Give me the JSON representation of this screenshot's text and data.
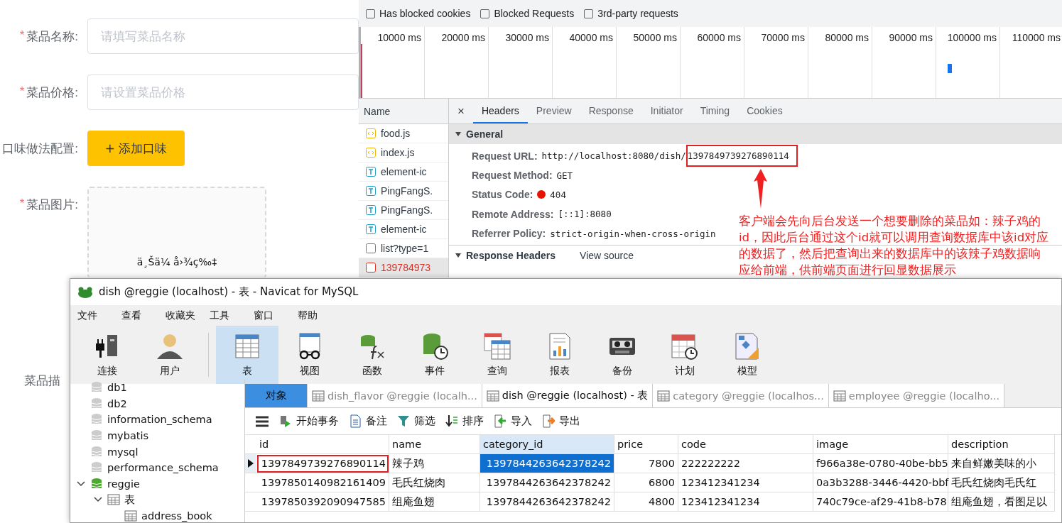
{
  "form": {
    "required_mark": "*",
    "fields": [
      {
        "label": "菜品名称:",
        "required": true,
        "kind": "input",
        "placeholder": "请填写菜品名称"
      },
      {
        "label": "菜品价格:",
        "required": true,
        "kind": "input",
        "placeholder": "请设置菜品价格"
      },
      {
        "label": "口味做法配置:",
        "required": false,
        "kind": "button",
        "button": "+ 添加口味"
      },
      {
        "label": "菜品图片:",
        "required": true,
        "kind": "upload",
        "upload_text": "ä¸Šä¼ å›¾ç‰‡"
      },
      {
        "label": "菜品描",
        "required": false,
        "kind": "label"
      }
    ]
  },
  "devtools": {
    "filters": [
      {
        "label": "Has blocked cookies",
        "checked": false
      },
      {
        "label": "Blocked Requests",
        "checked": false
      },
      {
        "label": "3rd-party requests",
        "checked": false
      }
    ],
    "timeline_ticks": [
      "10000 ms",
      "20000 ms",
      "30000 ms",
      "40000 ms",
      "50000 ms",
      "60000 ms",
      "70000 ms",
      "80000 ms",
      "90000 ms",
      "100000 ms",
      "110000 ms"
    ],
    "name_header": "Name",
    "requests": [
      {
        "name": "food.js",
        "kind": "script",
        "selected": false
      },
      {
        "name": "index.js",
        "kind": "script",
        "selected": false
      },
      {
        "name": "element-ic",
        "kind": "font",
        "selected": false
      },
      {
        "name": "PingFangS.",
        "kind": "font",
        "selected": false
      },
      {
        "name": "PingFangS.",
        "kind": "font",
        "selected": false
      },
      {
        "name": "element-ic",
        "kind": "font",
        "selected": false
      },
      {
        "name": "list?type=1",
        "kind": "xhr",
        "selected": false
      },
      {
        "name": "139784973",
        "kind": "error",
        "selected": true
      }
    ],
    "close": "×",
    "tabs": [
      {
        "label": "Headers",
        "selected": true
      },
      {
        "label": "Preview",
        "selected": false
      },
      {
        "label": "Response",
        "selected": false
      },
      {
        "label": "Initiator",
        "selected": false
      },
      {
        "label": "Timing",
        "selected": false
      },
      {
        "label": "Cookies",
        "selected": false
      }
    ],
    "general": {
      "title": "General",
      "expanded": true,
      "rows": [
        {
          "key": "Request URL:",
          "kind": "url",
          "value": "http://localhost:8080/dish/",
          "highlight": "1397849739276890114"
        },
        {
          "key": "Request Method:",
          "kind": "text",
          "value": "GET"
        },
        {
          "key": "Status Code:",
          "kind": "status",
          "value": "404",
          "color": "#e51400"
        },
        {
          "key": "Remote Address:",
          "kind": "text",
          "value": "[::1]:8080"
        },
        {
          "key": "Referrer Policy:",
          "kind": "text",
          "value": "strict-origin-when-cross-origin"
        }
      ]
    },
    "response_headers": {
      "title": "Response Headers",
      "expanded": true,
      "link": "View source"
    }
  },
  "annotation": {
    "text": "客户端会先向后台发送一个想要删除的菜品如：辣子鸡的id，因此后台通过这个id就可以调用查询数据库中该id对应的数据了，然后把查询出来的数据库中的该辣子鸡数据响应给前端，供前端页面进行回显数据展示"
  },
  "navicat": {
    "title": "dish @reggie (localhost) - 表 - Navicat for MySQL",
    "menu": [
      "文件",
      "查看",
      "收藏夹",
      "工具",
      "窗口",
      "帮助"
    ],
    "toolbar": [
      {
        "label": "连接",
        "kind": "connect",
        "selected": false
      },
      {
        "label": "用户",
        "kind": "user",
        "selected": false
      },
      {
        "label": "表",
        "kind": "table",
        "selected": true
      },
      {
        "label": "视图",
        "kind": "view",
        "selected": false
      },
      {
        "label": "函数",
        "kind": "function",
        "selected": false
      },
      {
        "label": "事件",
        "kind": "event",
        "selected": false
      },
      {
        "label": "查询",
        "kind": "query",
        "selected": false
      },
      {
        "label": "报表",
        "kind": "report",
        "selected": false
      },
      {
        "label": "备份",
        "kind": "backup",
        "selected": false
      },
      {
        "label": "计划",
        "kind": "schedule",
        "selected": false
      },
      {
        "label": "模型",
        "kind": "model",
        "selected": false
      }
    ],
    "tree": [
      {
        "label": "db1",
        "kind": "db"
      },
      {
        "label": "db2",
        "kind": "db"
      },
      {
        "label": "information_schema",
        "kind": "db"
      },
      {
        "label": "mybatis",
        "kind": "db"
      },
      {
        "label": "mysql",
        "kind": "db"
      },
      {
        "label": "performance_schema",
        "kind": "db"
      },
      {
        "label": "reggie",
        "kind": "db-open",
        "expanded": true,
        "children": [
          {
            "label": "表",
            "kind": "folder",
            "expanded": true,
            "children": [
              {
                "label": "address_book",
                "kind": "table"
              }
            ]
          }
        ]
      }
    ],
    "tabs": [
      {
        "label": "对象",
        "kind": "objects",
        "selected": false
      },
      {
        "label": "dish_flavor @reggie (localh...",
        "kind": "table",
        "selected": false
      },
      {
        "label": "dish @reggie (localhost) - 表",
        "kind": "table",
        "selected": true
      },
      {
        "label": "category @reggie (localhos...",
        "kind": "table",
        "selected": false
      },
      {
        "label": "employee @reggie (localho...",
        "kind": "table",
        "selected": false
      }
    ],
    "actions": [
      {
        "label": "开始事务",
        "kind": "transaction"
      },
      {
        "label": "备注",
        "kind": "memo"
      },
      {
        "label": "筛选",
        "kind": "filter"
      },
      {
        "label": "排序",
        "kind": "sort"
      },
      {
        "label": "导入",
        "kind": "import"
      },
      {
        "label": "导出",
        "kind": "export"
      }
    ],
    "columns": [
      {
        "label": "id",
        "selected": false
      },
      {
        "label": "name",
        "selected": false
      },
      {
        "label": "category_id",
        "selected": true
      },
      {
        "label": "price",
        "selected": false
      },
      {
        "label": "code",
        "selected": false
      },
      {
        "label": "image",
        "selected": false
      },
      {
        "label": "description",
        "selected": false
      }
    ],
    "rows": [
      {
        "cells": [
          "1397849739276890114",
          "辣子鸡",
          "1397844263642378242",
          "7800",
          "222222222",
          "f966a38e-0780-40be-bb5",
          "来自鲜嫩美味的小"
        ],
        "selected": true,
        "highlighted": true
      },
      {
        "cells": [
          "1397850140982161409",
          "毛氏红烧肉",
          "1397844263642378242",
          "6800",
          "123412341234",
          "0a3b3288-3446-4420-bbf",
          "毛氏红烧肉毛氏红"
        ],
        "selected": false,
        "highlighted": false
      },
      {
        "cells": [
          "1397850392090947585",
          "组庵鱼翅",
          "1397844263642378242",
          "4800",
          "123412341234",
          "740c79ce-af29-41b8-b78",
          "组庵鱼翅，看图足以"
        ],
        "selected": false,
        "highlighted": false
      }
    ]
  }
}
